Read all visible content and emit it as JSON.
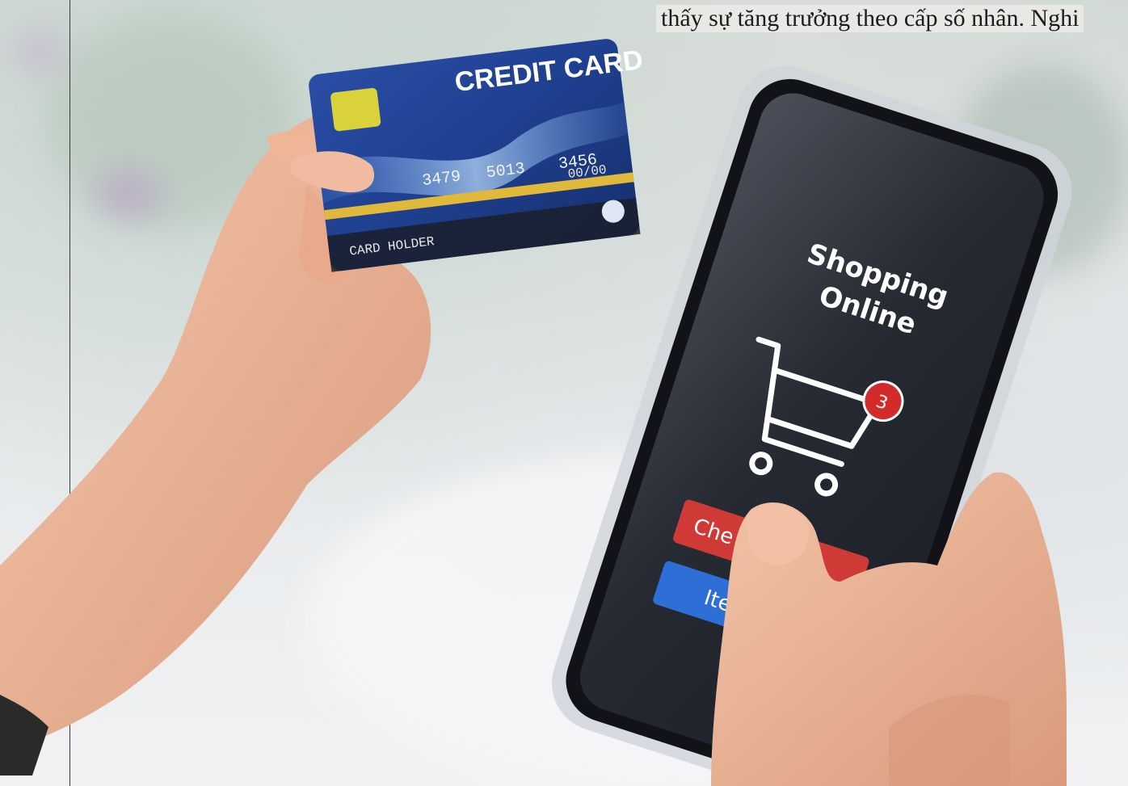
{
  "caption": {
    "text": "thấy sự tăng trưởng theo cấp số nhân. Nghi"
  },
  "credit_card": {
    "title": "CREDIT CARD",
    "number_groups": [
      "3479",
      "5013",
      "3456"
    ],
    "expiry": "00/00",
    "holder": "CARD HOLDER"
  },
  "phone_screen": {
    "title_line1": "Shopping",
    "title_line2": "Online",
    "cart_icon": "shopping-cart-icon",
    "cart_badge": "3",
    "checkout_button": "Che",
    "item_button": "Item"
  },
  "colors": {
    "card_blue": "#1f3f8f",
    "badge_red": "#d32a2a",
    "checkout_red": "#cf3a36",
    "item_blue": "#2d6fd6",
    "screen_dark": "#262a33",
    "skin": "#e9b294"
  }
}
